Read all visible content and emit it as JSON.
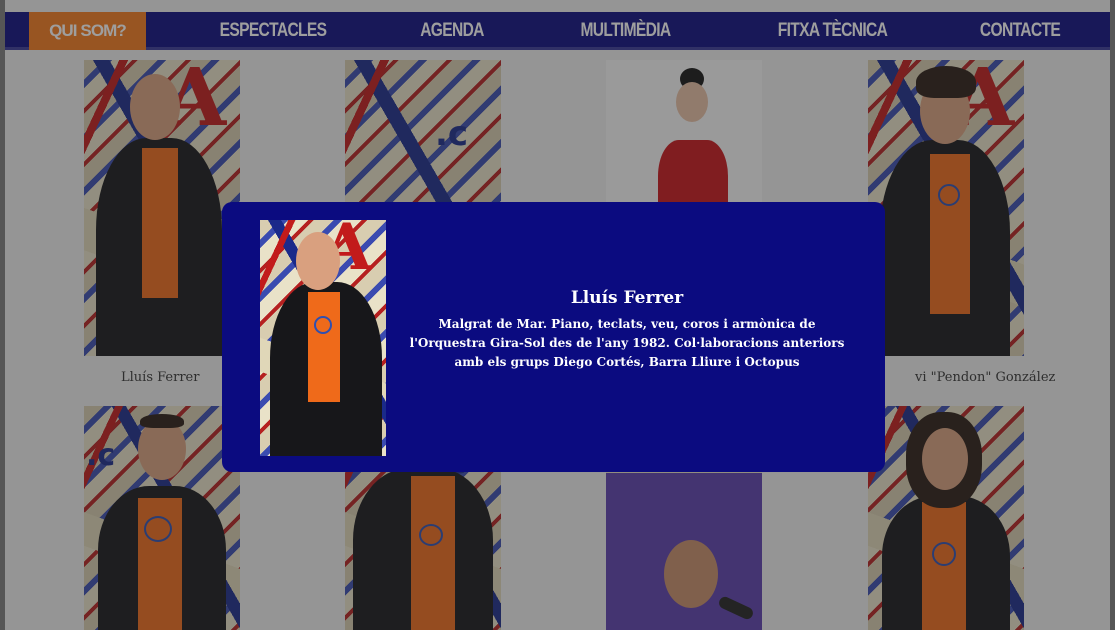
{
  "nav": {
    "items": [
      {
        "label": "QUI SOM?",
        "active": true
      },
      {
        "label": "ESPECTACLES",
        "active": false
      },
      {
        "label": "AGENDA",
        "active": false
      },
      {
        "label": "MULTIMÈDIA",
        "active": false
      },
      {
        "label": "FITXA TÈCNICA",
        "active": false
      },
      {
        "label": "CONTACTE",
        "active": false
      }
    ]
  },
  "members": {
    "captions": [
      "Lluís Ferrer",
      "vi \"Pendon\" González"
    ]
  },
  "modal": {
    "name": "Lluís Ferrer",
    "description": "Malgrat de Mar. Piano, teclats, veu, coros i armònica de l'Orquestra Gira-Sol des de l'any 1982. Col·laboracions anteriors amb els grups Diego Cortés, Barra Lliure i Octopus"
  },
  "colors": {
    "nav_bg": "#0b0b80",
    "nav_active": "#f47a1e",
    "modal_bg": "#0b0b80",
    "shirt_orange": "#ef6a1a"
  }
}
